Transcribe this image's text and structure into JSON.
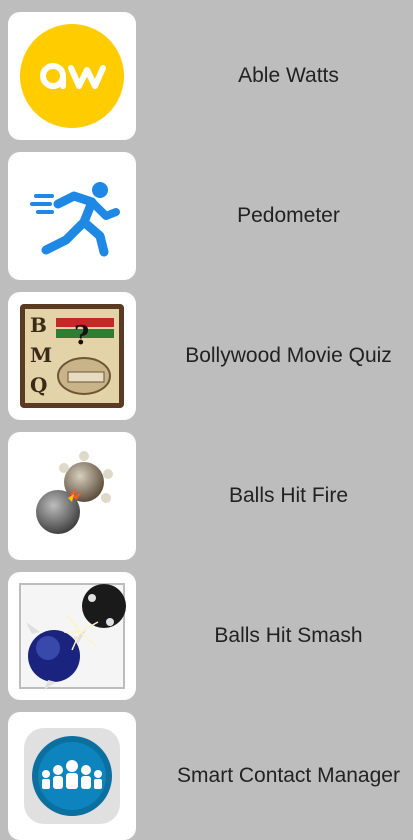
{
  "apps": [
    {
      "name": "Able Watts",
      "icon": "able-watts-icon"
    },
    {
      "name": "Pedometer",
      "icon": "running-man-icon"
    },
    {
      "name": "Bollywood Movie Quiz",
      "icon": "bmq-quiz-icon"
    },
    {
      "name": "Balls Hit Fire",
      "icon": "spiked-balls-fire-icon"
    },
    {
      "name": "Balls Hit Smash",
      "icon": "spiked-balls-smash-icon"
    },
    {
      "name": "Smart Contact Manager",
      "icon": "contacts-group-icon"
    }
  ],
  "colors": {
    "background": "#bdbdbd",
    "card": "#ffffff",
    "ableWattsYellow": "#ffcc00",
    "pedometerBlue": "#1e88e5",
    "contactsTeal": "#0b6fa0"
  }
}
